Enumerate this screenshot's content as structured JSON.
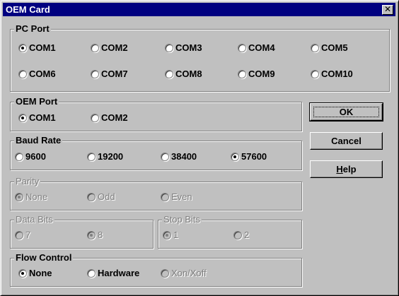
{
  "window": {
    "title": "OEM Card",
    "close_glyph": "✕"
  },
  "pc_port": {
    "label": "PC Port",
    "options": [
      "COM1",
      "COM2",
      "COM3",
      "COM4",
      "COM5",
      "COM6",
      "COM7",
      "COM8",
      "COM9",
      "COM10"
    ],
    "selected": "COM1"
  },
  "oem_port": {
    "label": "OEM Port",
    "options": [
      "COM1",
      "COM2"
    ],
    "selected": "COM1"
  },
  "baud_rate": {
    "label": "Baud Rate",
    "options": [
      "9600",
      "19200",
      "38400",
      "57600"
    ],
    "selected": "57600"
  },
  "parity": {
    "label": "Parity",
    "enabled": false,
    "options": [
      "None",
      "Odd",
      "Even"
    ],
    "selected": "None"
  },
  "data_bits": {
    "label": "Data Bits",
    "enabled": false,
    "options": [
      "7",
      "8"
    ],
    "selected": "8"
  },
  "stop_bits": {
    "label": "Stop Bits",
    "enabled": false,
    "options": [
      "1",
      "2"
    ],
    "selected": "1"
  },
  "flow_control": {
    "label": "Flow Control",
    "options": [
      {
        "text": "None",
        "enabled": true
      },
      {
        "text": "Hardware",
        "enabled": true
      },
      {
        "text": "Xon/Xoff",
        "enabled": false
      }
    ],
    "selected": "None"
  },
  "buttons": {
    "ok": "OK",
    "cancel": "Cancel",
    "help_first": "H",
    "help_rest": "elp"
  }
}
